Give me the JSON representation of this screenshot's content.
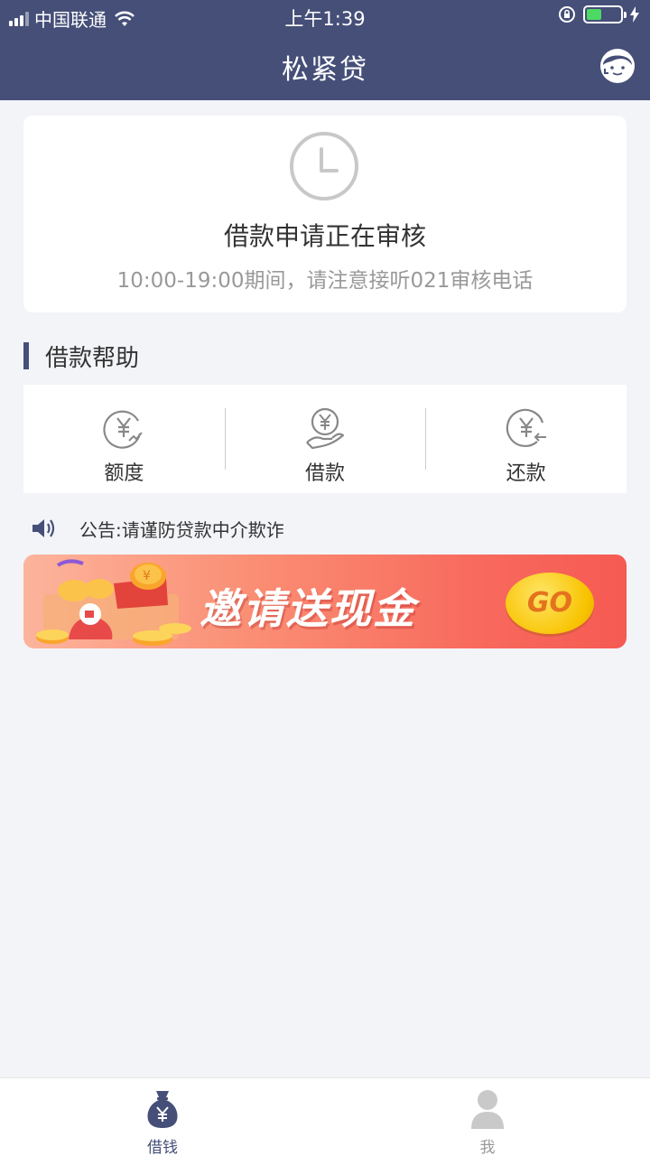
{
  "status_bar": {
    "carrier": "中国联通",
    "time": "上午1:39",
    "battery_level": 0.45
  },
  "header": {
    "title": "松紧贷",
    "service_icon": "customer-service-icon"
  },
  "status_card": {
    "icon": "clock-icon",
    "title": "借款申请正在审核",
    "subtitle": "10:00-19:00期间，请注意接听021审核电话"
  },
  "help_section": {
    "title": "借款帮助",
    "items": [
      {
        "label": "额度",
        "icon": "quota-yen-icon"
      },
      {
        "label": "借款",
        "icon": "borrow-yen-hand-icon"
      },
      {
        "label": "还款",
        "icon": "repay-yen-arrow-icon"
      }
    ]
  },
  "notice": {
    "icon": "speaker-icon",
    "text": "公告:请谨防贷款中介欺诈"
  },
  "banner": {
    "text": "邀请送现金",
    "button": "GO"
  },
  "tabbar": {
    "tabs": [
      {
        "label": "借钱",
        "icon": "money-bag-icon",
        "active": true
      },
      {
        "label": "我",
        "icon": "user-icon",
        "active": false
      }
    ]
  },
  "colors": {
    "primary": "#454f78",
    "background": "#f3f4f8",
    "banner_start": "#fcb49c",
    "banner_end": "#f55a53",
    "go_button": "#f8c300"
  }
}
